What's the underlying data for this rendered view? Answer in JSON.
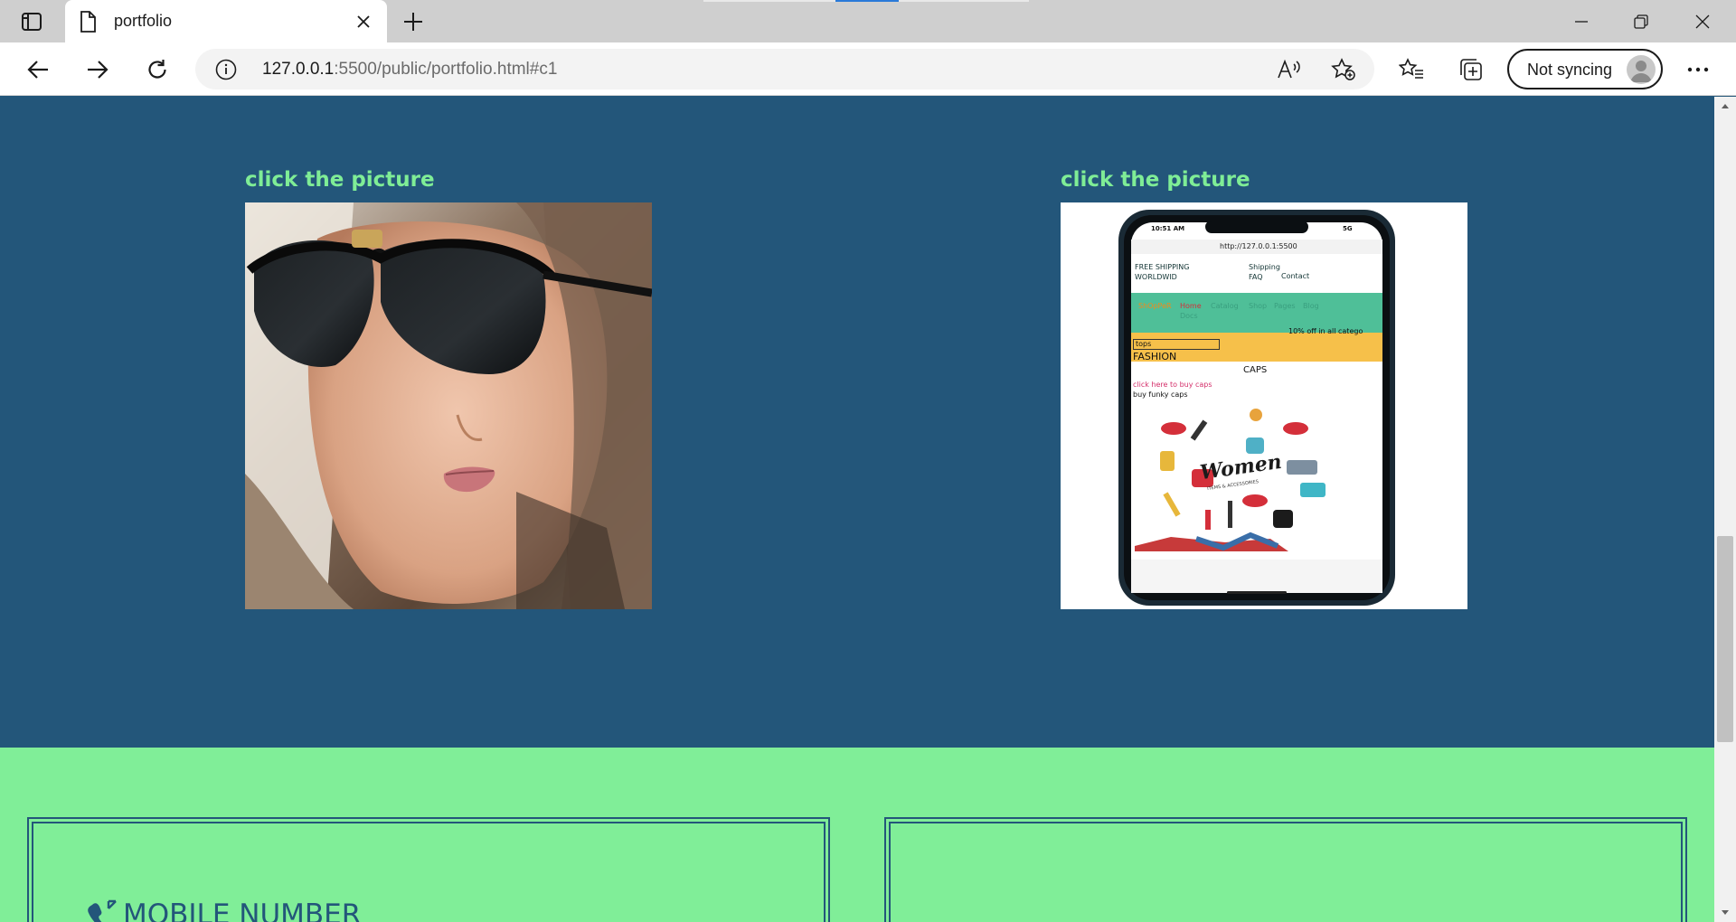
{
  "browser": {
    "tab_title": "portfolio",
    "url_host": "127.0.0.1",
    "url_path": ":5500/public/portfolio.html#c1",
    "sync_label": "Not syncing"
  },
  "portfolio": {
    "cards": [
      {
        "caption": "click the picture",
        "image": "woman-with-sunglasses-photo"
      },
      {
        "caption": "click the picture",
        "image": "phone-shop-screenshot"
      }
    ]
  },
  "phone_screen": {
    "time": "10:51 AM",
    "signal": "5G",
    "address": "http://127.0.0.1:5500",
    "top_bar": [
      "FREE SHIPPING WORLDWID",
      "Shipping FAQ",
      "Contact"
    ],
    "brand": "ShOpPeR",
    "nav": [
      "Home",
      "Catalog",
      "Shop",
      "Pages",
      "Blog",
      "Docs"
    ],
    "promo": "10% off in all catego",
    "select_value": "tops",
    "heading": "FASHION",
    "subheading": "CAPS",
    "link": "click here to buy caps",
    "tagline": "buy funky caps",
    "poster_text": "Women",
    "poster_sub": "ITEMS & ACCESSORIES"
  },
  "contact": {
    "mobile_label": "MOBILE NUMBER"
  },
  "colors": {
    "dark_blue": "#23567a",
    "mint": "#80ee98",
    "caption_green": "#7fed96"
  }
}
